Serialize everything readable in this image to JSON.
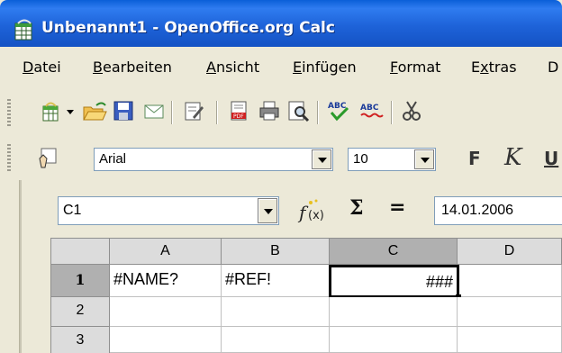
{
  "window": {
    "title": "Unbenannt1 - OpenOffice.org Calc",
    "app_icon": "calc-app-icon"
  },
  "menubar": {
    "items": [
      {
        "label": "Datei",
        "mnemonic": "D",
        "rest": "atei"
      },
      {
        "label": "Bearbeiten",
        "mnemonic": "B",
        "rest": "earbeiten"
      },
      {
        "label": "Ansicht",
        "mnemonic": "A",
        "rest": "nsicht"
      },
      {
        "label": "Einfügen",
        "mnemonic": "E",
        "rest": "infügen"
      },
      {
        "label": "Format",
        "mnemonic": "F",
        "rest": "ormat"
      },
      {
        "label": "Extras",
        "pre": "E",
        "mnemonic": "x",
        "rest": "tras"
      },
      {
        "label": "D",
        "mnemonic": "",
        "rest": "D"
      }
    ]
  },
  "toolbar_standard": {
    "icons": [
      "new-document-icon",
      "new-dropdown-icon",
      "open-folder-icon",
      "save-icon",
      "email-icon",
      "edit-file-icon",
      "export-pdf-icon",
      "print-icon",
      "page-preview-icon",
      "spellcheck-icon",
      "autospellcheck-icon",
      "cut-icon"
    ]
  },
  "toolbar_formatting": {
    "font_name": "Arial",
    "font_size": "10",
    "bold_label": "F",
    "italic_label": "K",
    "underline_label": "U"
  },
  "formula_bar": {
    "name_box": "C1",
    "function_wizard_icon": "function-wizard-icon",
    "sum_label": "Σ",
    "equals_label": "=",
    "input_value": "14.01.2006"
  },
  "sheet": {
    "columns": [
      "A",
      "B",
      "C",
      "D"
    ],
    "rows": [
      "1",
      "2",
      "3"
    ],
    "cells": {
      "A1": "#NAME?",
      "B1": "#REF!",
      "C1": "###"
    },
    "active_cell": "C1",
    "active_column": "C",
    "active_row": "1"
  }
}
